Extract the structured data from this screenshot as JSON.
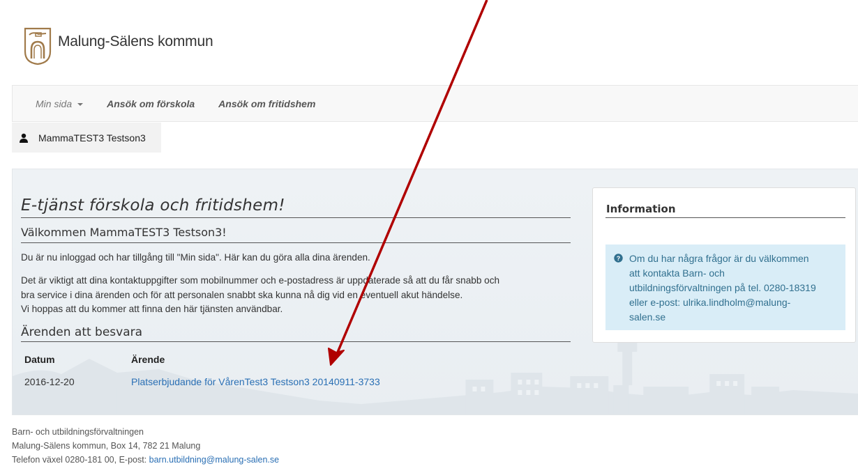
{
  "header": {
    "logo_text": "Malung-Sälens kommun"
  },
  "nav": {
    "min_sida": "Min sida",
    "items": [
      "Ansök om förskola",
      "Ansök om fritidshem"
    ]
  },
  "user": {
    "name": "MammaTEST3 Testson3"
  },
  "main": {
    "title": "E-tjänst förskola och fritidshem!",
    "welcome": "Välkommen MammaTEST3 Testson3!",
    "p1": "Du är nu inloggad och har tillgång till \"Min sida\". Här kan du göra alla dina ärenden.",
    "p2_line1": "Det är viktigt att dina kontaktuppgifter som mobilnummer och e-postadress är uppdaterade så att du får snabb och",
    "p2_line2": "bra service i dina ärenden och för att personalen snabbt ska kunna nå dig vid en eventuell akut händelse.",
    "p2_line3": "Vi hoppas att du kommer att finna den här tjänsten användbar.",
    "arenden_heading": "Ärenden att besvara",
    "table": {
      "headers": [
        "Datum",
        "Ärende"
      ],
      "rows": [
        {
          "datum": "2016-12-20",
          "arende": "Platserbjudande för VårenTest3 Testson3 20140911-3733"
        }
      ]
    }
  },
  "info": {
    "title": "Information",
    "line1": "Om du har några frågor är du välkommen",
    "line2": "att kontakta Barn- och",
    "line3": "utbildningsförvaltningen på tel. 0280-18319",
    "line4": "eller e-post: ulrika.lindholm@malung-",
    "line5": "salen.se"
  },
  "footer": {
    "line1": "Barn- och utbildningsförvaltningen",
    "line2": "Malung-Sälens kommun, Box 14, 782 21 Malung",
    "line3_prefix": "Telefon växel 0280-181 00, E-post: ",
    "email": "barn.utbildning@malung-salen.se"
  },
  "colors": {
    "link": "#2a6fb4",
    "annotation_arrow": "#b00000",
    "info_bg": "#d9edf7"
  },
  "icons": [
    "logo-emblem-icon",
    "user-icon",
    "question-icon",
    "annotation-arrow"
  ]
}
